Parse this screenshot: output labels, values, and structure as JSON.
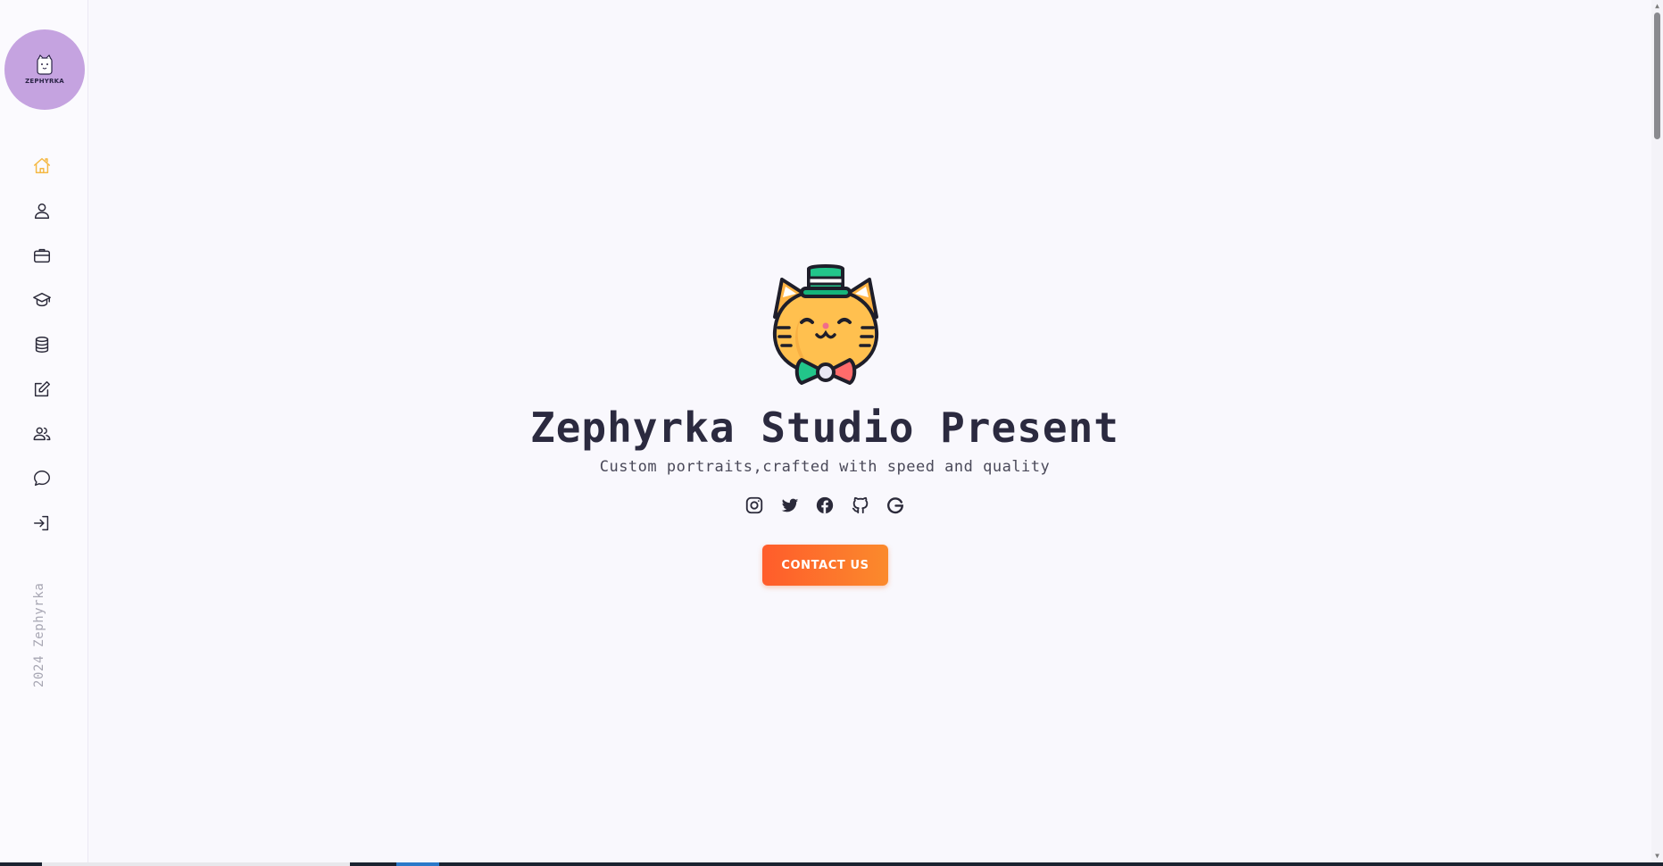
{
  "sidebar": {
    "logo": {
      "text": "ZEPHYRKA",
      "bg_color": "#c5a3e0"
    },
    "nav_items": [
      {
        "icon": "home-icon",
        "active": true
      },
      {
        "icon": "user-icon",
        "active": false
      },
      {
        "icon": "briefcase-icon",
        "active": false
      },
      {
        "icon": "graduation-cap-icon",
        "active": false
      },
      {
        "icon": "database-icon",
        "active": false
      },
      {
        "icon": "edit-icon",
        "active": false
      },
      {
        "icon": "users-icon",
        "active": false
      },
      {
        "icon": "chat-icon",
        "active": false
      },
      {
        "icon": "sign-in-icon",
        "active": false
      }
    ],
    "copyright": "2024 Zephyrka",
    "active_color": "#f5b843"
  },
  "hero": {
    "title": "Zephyrka Studio Present",
    "subtitle": "Custom portraits,crafted with speed and quality",
    "socials": [
      {
        "icon": "instagram-icon"
      },
      {
        "icon": "twitter-icon"
      },
      {
        "icon": "facebook-icon"
      },
      {
        "icon": "github-icon"
      },
      {
        "icon": "google-icon"
      }
    ],
    "contact_button": "CONTACT US",
    "button_gradient": [
      "#ff5c2b",
      "#fb8a2c"
    ]
  }
}
